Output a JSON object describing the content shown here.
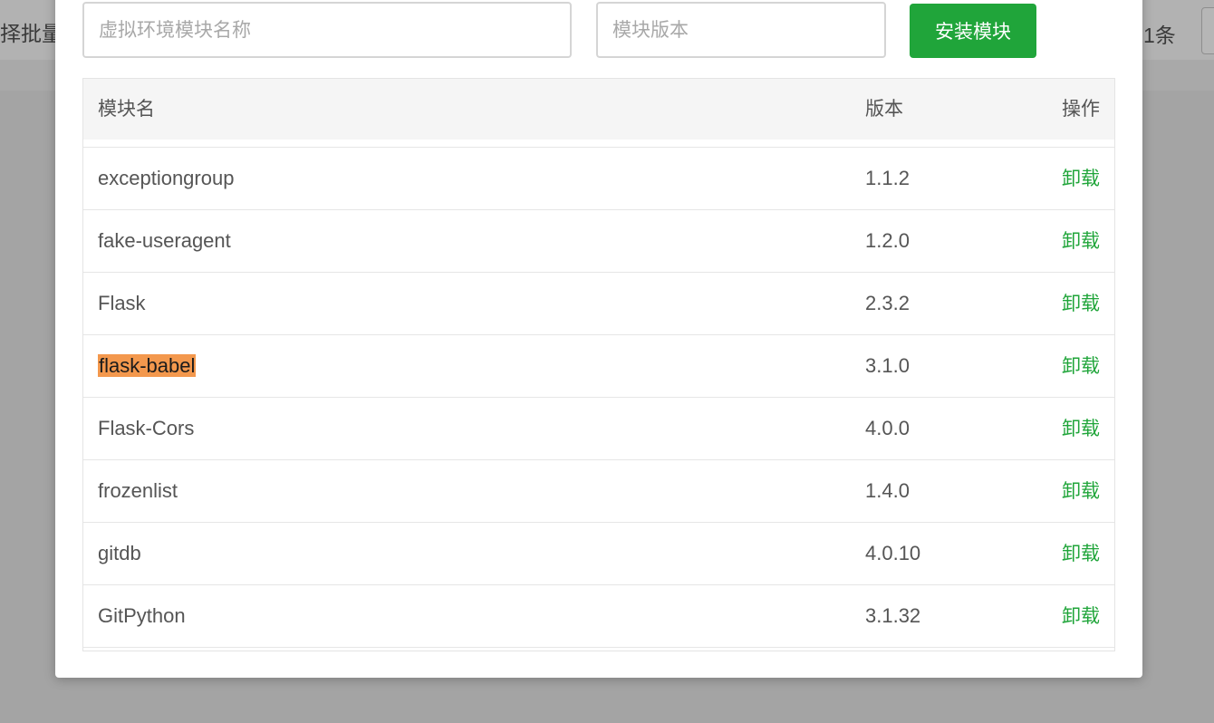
{
  "background": {
    "left_text": "择批量",
    "right_text": "1条"
  },
  "modal": {
    "name_input_placeholder": "虚拟环境模块名称",
    "version_input_placeholder": "模块版本",
    "install_button": "安装模块",
    "table": {
      "headers": {
        "name": "模块名",
        "version": "版本",
        "action": "操作"
      },
      "rows": [
        {
          "name": "exceptiongroup",
          "version": "1.1.2",
          "action": "卸载"
        },
        {
          "name": "fake-useragent",
          "version": "1.2.0",
          "action": "卸载"
        },
        {
          "name": "Flask",
          "version": "2.3.2",
          "action": "卸载"
        },
        {
          "name": "flask-babel",
          "version": "3.1.0",
          "action": "卸载"
        },
        {
          "name": "Flask-Cors",
          "version": "4.0.0",
          "action": "卸载"
        },
        {
          "name": "frozenlist",
          "version": "1.4.0",
          "action": "卸载"
        },
        {
          "name": "gitdb",
          "version": "4.0.10",
          "action": "卸载"
        },
        {
          "name": "GitPython",
          "version": "3.1.32",
          "action": "卸载"
        },
        {
          "name": "",
          "version": "",
          "action": ""
        }
      ],
      "highlighted_name": "flask-babel"
    }
  },
  "colors": {
    "accent": "#20a53a",
    "highlight": "#f3984d",
    "overlay": "#a4a4a4"
  }
}
